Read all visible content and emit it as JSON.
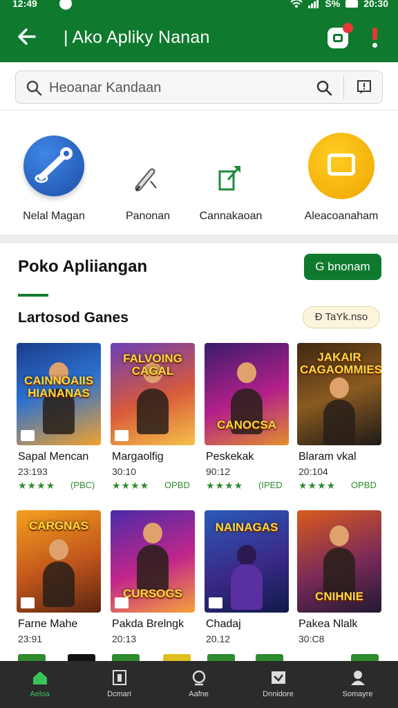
{
  "status_bar": {
    "time": "12:49",
    "battery": "S%",
    "clock_right": "20:30"
  },
  "app_bar": {
    "title": "| Ako Apliky Nanan"
  },
  "search": {
    "placeholder": "Heoanar Kandaan"
  },
  "categories": [
    {
      "label": "Nelal Magan",
      "icon": "wrench-bubble-icon"
    },
    {
      "label": "Panonan",
      "icon": "pen-icon"
    },
    {
      "label": "Cannakaoan",
      "icon": "share-doc-icon"
    },
    {
      "label": "Aleacoanaham",
      "icon": "chat-bubble-icon"
    }
  ],
  "section": {
    "title": "Poko Apliiangan",
    "button": "G bnonam"
  },
  "subsection": {
    "title": "Lartosod Ganes",
    "pill": "Ð TaYk.nso"
  },
  "games": [
    {
      "art": "CAINNOAIIS HIANANAS",
      "name": "Sapal Mencan",
      "num": "23:193",
      "stars": "★★★★",
      "tag": "(PBC)"
    },
    {
      "art": "FALVOING CAGAL",
      "name": "Margaolfig",
      "num": "30:10",
      "stars": "★★★★",
      "tag": "OPBD"
    },
    {
      "art": "CANOCSA",
      "name": "Peskekak",
      "num": "90:12",
      "stars": "★★★★",
      "tag": "(IPED"
    },
    {
      "art": "JAKAIR CAGAOMMIES",
      "name": "Blaram vkal",
      "num": "20:104",
      "stars": "★★★★",
      "tag": "OPBD"
    },
    {
      "art": "CARGNAS",
      "name": "Farne Mahe",
      "num": "23:91",
      "stars": "",
      "tag": ""
    },
    {
      "art": "CURSOGS",
      "name": "Pakda Brelngk",
      "num": "20:13",
      "stars": "",
      "tag": ""
    },
    {
      "art": "NAINAGAS",
      "name": "Chadaj",
      "num": "20.12",
      "stars": "",
      "tag": ""
    },
    {
      "art": "CNIHNIE",
      "name": "Pakea Nlalk",
      "num": "30:C8",
      "stars": "",
      "tag": ""
    }
  ],
  "bottom_nav": [
    {
      "label": "Aeloa",
      "icon": "home-icon",
      "active": true
    },
    {
      "label": "Dcmari",
      "icon": "apps-icon",
      "active": false
    },
    {
      "label": "Aafne",
      "icon": "search-icon",
      "active": false
    },
    {
      "label": "Dnnidore",
      "icon": "image-icon",
      "active": false
    },
    {
      "label": "Somayre",
      "icon": "profile-icon",
      "active": false
    }
  ],
  "colors": {
    "brand": "#0f7a2e",
    "accent_green": "#3bc25a",
    "nav_bg": "#2b2b2b"
  }
}
